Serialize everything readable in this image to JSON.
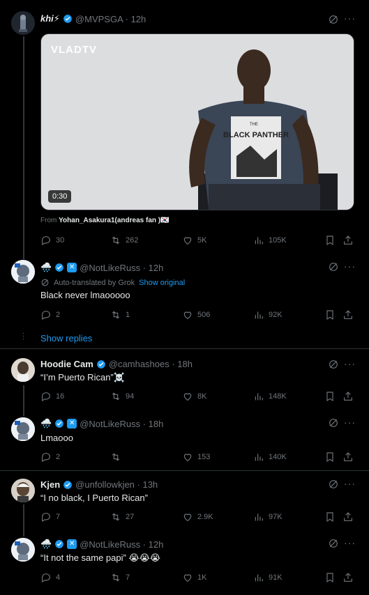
{
  "colors": {
    "background": "#000000",
    "text": "#e7e9ea",
    "muted": "#71767b",
    "accent": "#1d9bf0",
    "divider": "#2f3336"
  },
  "tweets": [
    {
      "name": "khi⚡",
      "handle": "@MVPSGA · 12h",
      "video": {
        "watermark": "VLADTV",
        "duration": "0:30",
        "shirt_text": "BLACK PANTHER",
        "shirt_top": "THE"
      },
      "from_label": "From",
      "from_user": "Yohan_Asakura1(andreas fan )🇰🇷",
      "stats": {
        "replies": "30",
        "reposts": "262",
        "likes": "5K",
        "views": "105K"
      }
    },
    {
      "name": "🌧️",
      "handle": "@NotLikeRuss · 12h",
      "translated_label": "Auto-translated by Grok",
      "show_original": "Show original",
      "text": "Black never lmaooooo",
      "stats": {
        "replies": "2",
        "reposts": "1",
        "likes": "506",
        "views": "92K"
      },
      "show_replies": "Show replies"
    },
    {
      "name": "Hoodie Cam",
      "handle": "@camhashoes · 18h",
      "text": "“I’m Puerto Rican”☠️",
      "stats": {
        "replies": "16",
        "reposts": "94",
        "likes": "8K",
        "views": "148K"
      }
    },
    {
      "name": "🌧️",
      "handle": "@NotLikeRuss · 18h",
      "text": "Lmaooo",
      "stats": {
        "replies": "2",
        "reposts": "",
        "likes": "153",
        "views": "140K"
      }
    },
    {
      "name": "Kjen",
      "handle": "@unfollowkjen · 13h",
      "text": "“I no black, I Puerto Rican”",
      "stats": {
        "replies": "7",
        "reposts": "27",
        "likes": "2.9K",
        "views": "97K"
      }
    },
    {
      "name": "🌧️",
      "handle": "@NotLikeRuss · 12h",
      "text": "“It not the same papi” 😭😭😭",
      "stats": {
        "replies": "4",
        "reposts": "7",
        "likes": "1K",
        "views": "91K"
      }
    }
  ]
}
